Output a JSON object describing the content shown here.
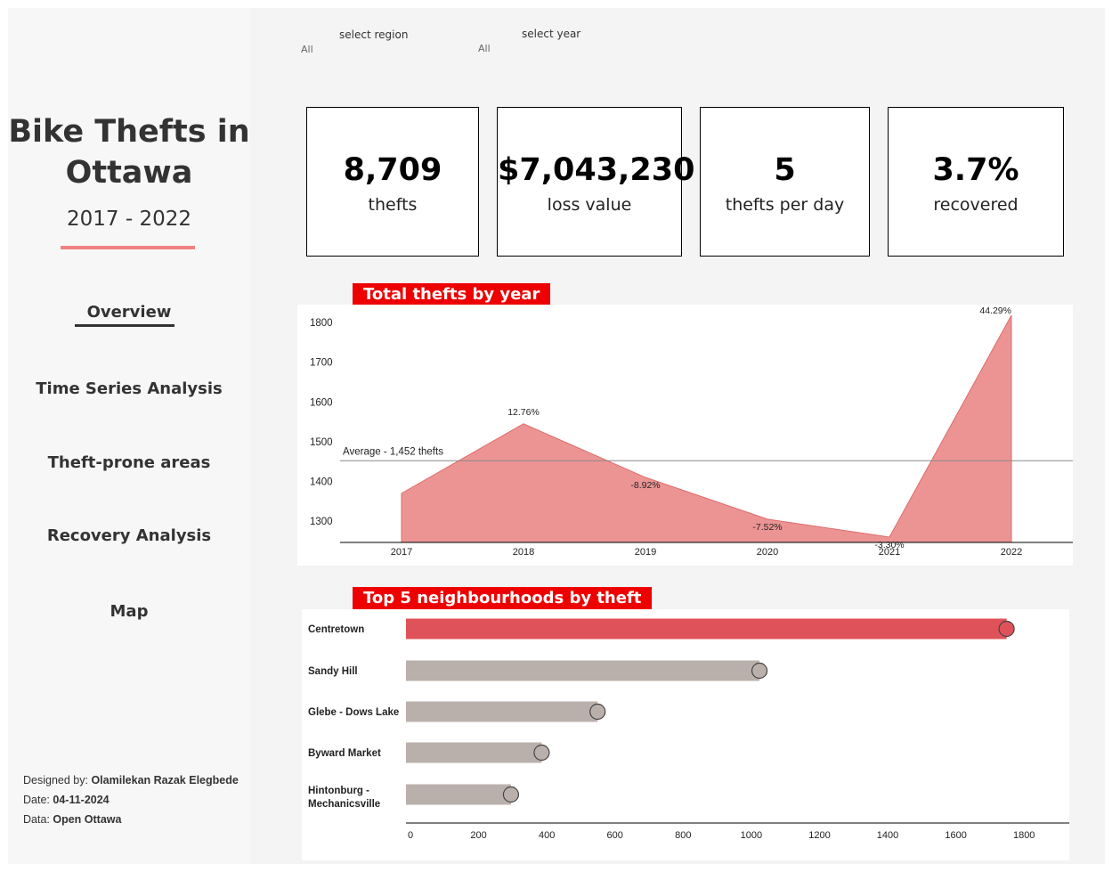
{
  "sidebar": {
    "title_line1": "Bike Thefts in",
    "title_line2": "Ottawa",
    "years": "2017 - 2022",
    "nav": [
      {
        "label": "Overview",
        "active": true
      },
      {
        "label": "Time Series Analysis",
        "active": false
      },
      {
        "label": "Theft-prone areas",
        "active": false
      },
      {
        "label": "Recovery Analysis",
        "active": false
      },
      {
        "label": "Map",
        "active": false
      }
    ],
    "credits": {
      "designed_label": "Designed by:",
      "designed_value": "Olamilekan Razak Elegbede",
      "date_label": "Date:",
      "date_value": "04-11-2024",
      "data_label": "Data:",
      "data_value": "Open Ottawa"
    }
  },
  "filters": {
    "region": {
      "label": "select region",
      "value": "All"
    },
    "year": {
      "label": "select year",
      "value": "All"
    }
  },
  "kpis": [
    {
      "value": "8,709",
      "label": "thefts"
    },
    {
      "value": "$7,043,230",
      "label": "loss value"
    },
    {
      "value": "5",
      "label": "thefts per day"
    },
    {
      "value": "3.7%",
      "label": "recovered"
    }
  ],
  "colors": {
    "accent_red": "#ee0000",
    "area_fill": "#ec9494",
    "area_stroke": "#e06a6a",
    "bar_highlight": "#e0525a",
    "bar_default": "#bab0ab",
    "underline_pink": "#f08080"
  },
  "chart_data": [
    {
      "type": "area",
      "title": "Total thefts by year",
      "x": [
        "2017",
        "2018",
        "2019",
        "2020",
        "2021",
        "2022"
      ],
      "values": [
        1370,
        1545,
        1410,
        1305,
        1260,
        1818
      ],
      "labels": [
        "",
        "12.76%",
        "-8.92%",
        "-7.52%",
        "-3.30%",
        "44.29%"
      ],
      "ylim": [
        1224,
        1845
      ],
      "yticks": [
        1300,
        1400,
        1500,
        1600,
        1700,
        1800
      ],
      "reference_line": {
        "value": 1452,
        "label": "Average - 1,452 thefts"
      }
    },
    {
      "type": "bar",
      "orientation": "horizontal",
      "title": "Top 5 neighbourhoods by theft",
      "categories": [
        "Centretown",
        "Sandy Hill",
        "Glebe - Dows Lake",
        "Byward Market",
        "Hintonburg - Mechanicsville"
      ],
      "values": [
        1762,
        1037,
        562,
        398,
        308
      ],
      "xlim": [
        0,
        1870
      ],
      "xticks": [
        0,
        200,
        400,
        600,
        800,
        1000,
        1200,
        1400,
        1600,
        1800
      ]
    }
  ]
}
